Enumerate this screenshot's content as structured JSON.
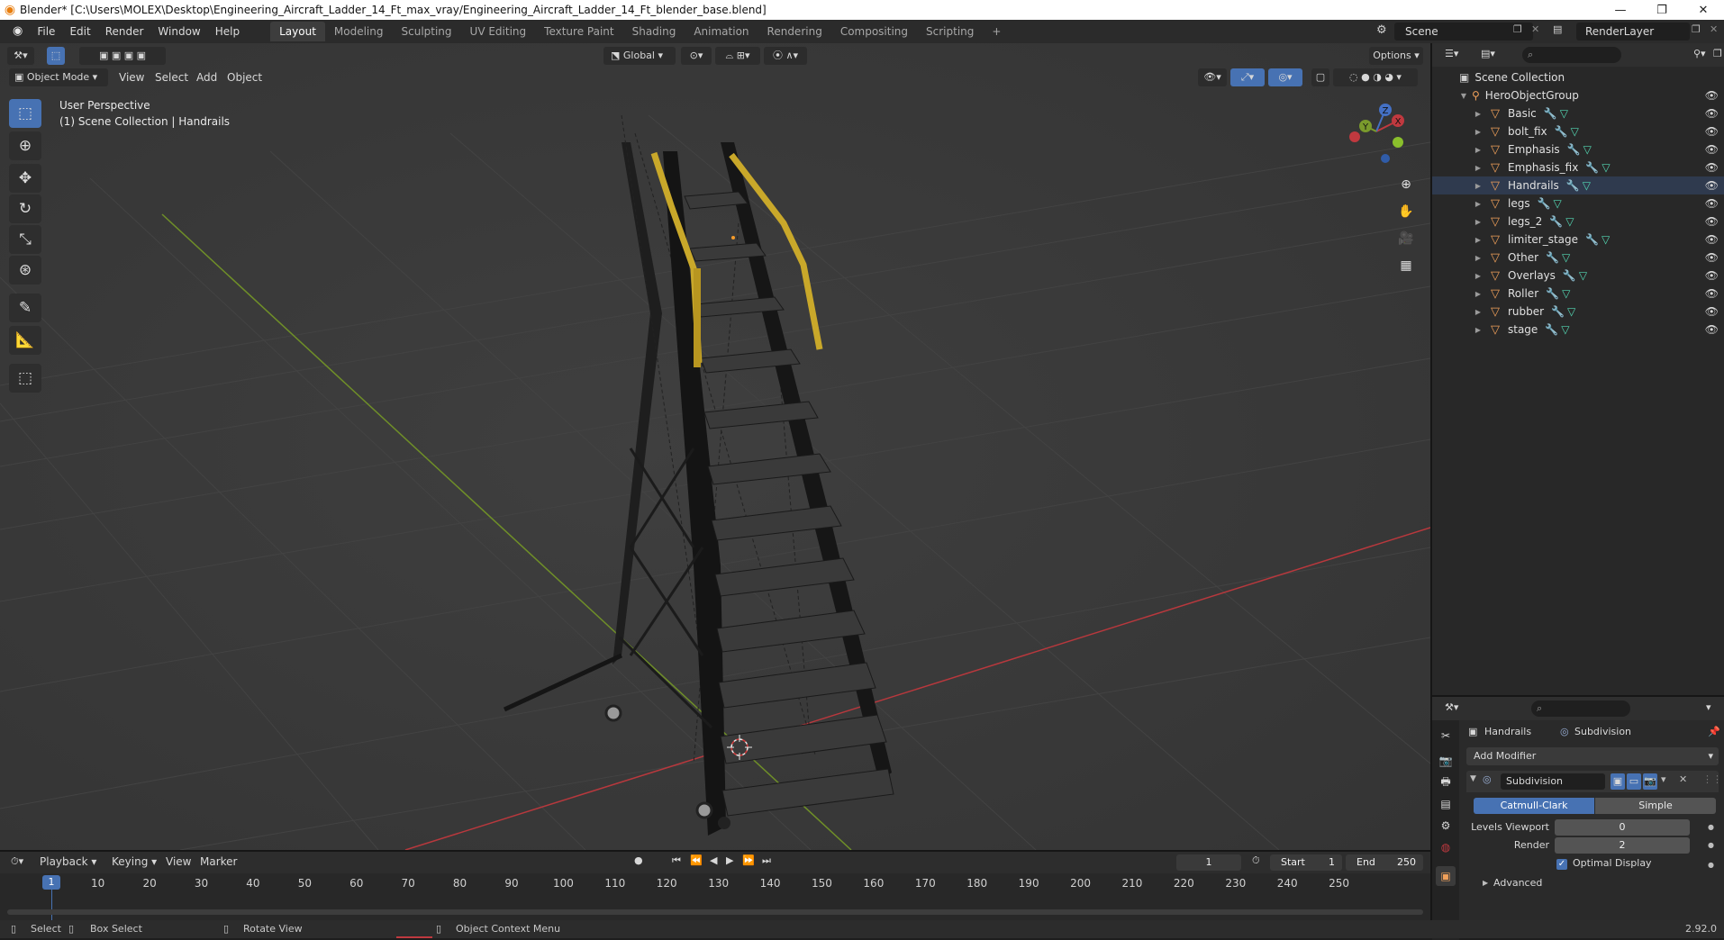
{
  "window": {
    "title": "Blender* [C:\\Users\\MOLEX\\Desktop\\Engineering_Aircraft_Ladder_14_Ft_max_vray/Engineering_Aircraft_Ladder_14_Ft_blender_base.blend]",
    "controls": [
      "—",
      "❐",
      "✕"
    ]
  },
  "menubar": {
    "items": [
      "File",
      "Edit",
      "Render",
      "Window",
      "Help"
    ],
    "workspaces": [
      "Layout",
      "Modeling",
      "Sculpting",
      "UV Editing",
      "Texture Paint",
      "Shading",
      "Animation",
      "Rendering",
      "Compositing",
      "Scripting"
    ],
    "active_workspace": "Layout",
    "add_workspace": "+",
    "scene": "Scene",
    "render_layer": "RenderLayer"
  },
  "viewport": {
    "mode": "Object Mode",
    "menus": [
      "View",
      "Select",
      "Add",
      "Object"
    ],
    "transform_orientation": "Global",
    "options_label": "Options",
    "perspective_label": "User Perspective",
    "context_label": "(1) Scene Collection | Handrails",
    "gizmo": {
      "x": "X",
      "y": "Y",
      "z": "Z"
    }
  },
  "outliner": {
    "root": "Scene Collection",
    "group": "HeroObjectGroup",
    "objects": [
      "Basic",
      "bolt_fix",
      "Emphasis",
      "Emphasis_fix",
      "Handrails",
      "legs",
      "legs_2",
      "limiter_stage",
      "Other",
      "Overlays",
      "Roller",
      "rubber",
      "stage"
    ]
  },
  "properties": {
    "object": "Handrails",
    "modifier_breadcrumb": "Subdivision",
    "add_modifier": "Add Modifier",
    "modifier_name": "Subdivision",
    "algorithms": [
      "Catmull-Clark",
      "Simple"
    ],
    "active_algorithm": "Catmull-Clark",
    "levels_viewport_label": "Levels Viewport",
    "levels_viewport": "0",
    "render_label": "Render",
    "render_levels": "2",
    "optimal_display_label": "Optimal Display",
    "optimal_display": true,
    "advanced_label": "Advanced"
  },
  "timeline": {
    "menus": [
      "Playback",
      "Keying",
      "View",
      "Marker"
    ],
    "current_frame": "1",
    "start_label": "Start",
    "start": "1",
    "end_label": "End",
    "end": "250",
    "ticks": [
      "1",
      "10",
      "20",
      "30",
      "40",
      "50",
      "60",
      "70",
      "80",
      "90",
      "100",
      "110",
      "120",
      "130",
      "140",
      "150",
      "160",
      "170",
      "180",
      "190",
      "200",
      "210",
      "220",
      "230",
      "240",
      "250"
    ]
  },
  "statusbar": {
    "select": "Select",
    "box_select": "Box Select",
    "rotate_view": "Rotate View",
    "context_menu": "Object Context Menu",
    "version": "2.92.0"
  },
  "colors": {
    "accent": "#4772b3",
    "handrail_yellow": "#c9a82a",
    "x_axis": "#c0393f",
    "y_axis": "#7a9a2c",
    "object_orange": "#f0a05a"
  }
}
